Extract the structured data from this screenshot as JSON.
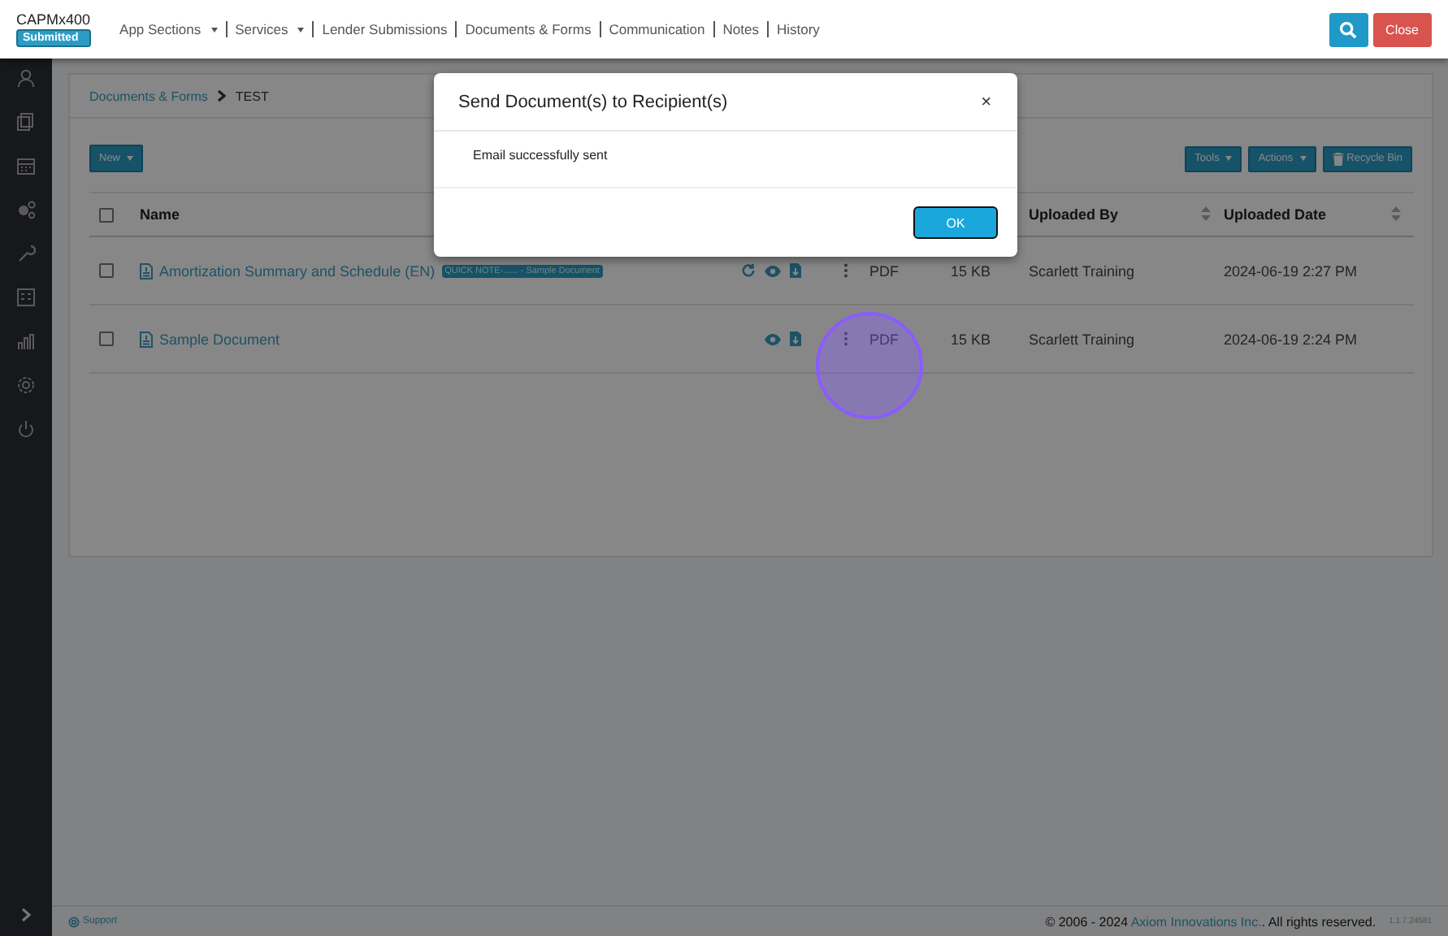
{
  "app": {
    "name": "CAPMx400",
    "status": "Submitted"
  },
  "nav": [
    {
      "label": "App Sections",
      "dropdown": true
    },
    {
      "label": "Services",
      "dropdown": true
    },
    {
      "label": "Lender Submissions",
      "dropdown": false
    },
    {
      "label": "Documents & Forms",
      "dropdown": false
    },
    {
      "label": "Communication",
      "dropdown": false
    },
    {
      "label": "Notes",
      "dropdown": false
    },
    {
      "label": "History",
      "dropdown": false
    }
  ],
  "close_button": "Close",
  "breadcrumb": [
    "Documents & Forms",
    "TEST"
  ],
  "new_button": "New",
  "toolbar": [
    {
      "label": "Tools",
      "kind": "dropdown"
    },
    {
      "label": "Actions",
      "kind": "dropdown"
    },
    {
      "label": "Recycle Bin",
      "kind": "trash"
    }
  ],
  "table": {
    "select_all_checked": false,
    "columns": {
      "name": "Name",
      "uploaded_by": "Uploaded By",
      "uploaded_date": "Uploaded Date"
    },
    "rows": [
      {
        "checked": false,
        "name": "Amortization Summary and Schedule (EN)",
        "tag": "QUICK NOTE-...... - Sample Document",
        "refresh_icon": true,
        "type": "PDF",
        "size": "15 KB",
        "uploaded_by": "Scarlett Training",
        "uploaded_date": "2024-06-19 2:27 PM"
      },
      {
        "checked": false,
        "name": "Sample Document",
        "refresh_icon": false,
        "type": "PDF",
        "size": "15 KB",
        "uploaded_by": "Scarlett Training",
        "uploaded_date": "2024-06-19 2:24 PM"
      }
    ]
  },
  "footer": {
    "support": "Support",
    "copyright_prefix": "© 2006 - 2024",
    "company": "Axiom Innovations Inc.",
    "copyright_suffix": ". All rights reserved.",
    "version": "1.1.7.24581"
  },
  "modal": {
    "title": "Send Document(s) to Recipient(s)",
    "close": "×",
    "message": "Email successfully sent",
    "ok": "OK"
  }
}
